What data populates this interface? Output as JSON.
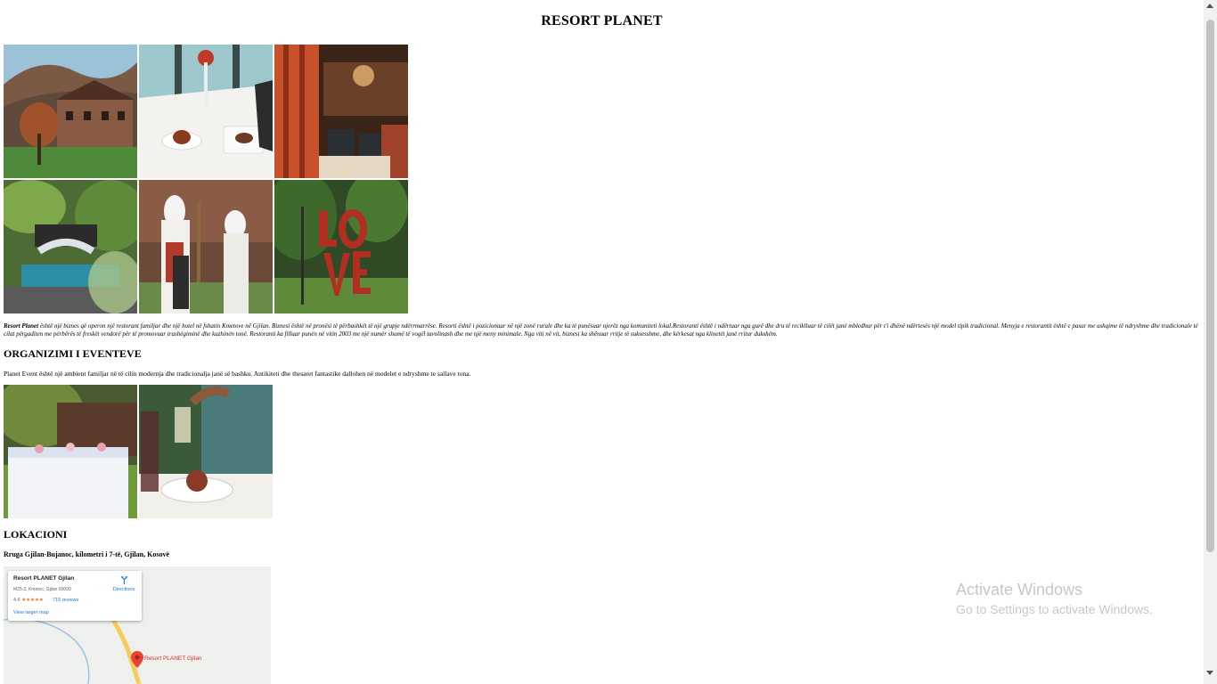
{
  "page": {
    "title": "RESORT PLANET"
  },
  "gallery": {
    "images": [
      {
        "name": "resort-exterior-photo",
        "alt": "resort exterior"
      },
      {
        "name": "table-dessert-photo",
        "alt": "dessert table"
      },
      {
        "name": "restaurant-interior-photo",
        "alt": "restaurant interior"
      },
      {
        "name": "pool-bridge-photo",
        "alt": "pool bridge"
      },
      {
        "name": "traditional-dress-photo",
        "alt": "traditional dress"
      },
      {
        "name": "love-sculpture-photo",
        "alt": "love sculpture"
      }
    ]
  },
  "intro": {
    "brand": "Resort Planet",
    "text": " është një biznes që operon një restorant familjar dhe një hotel në fshatin Kmetove në Gjilan. Biznesi është në pronësi të përbashkët të një grupje ndërrmarrëse. Resorti është i pozicionuar në një zonë rurale dhe ka të punësuar njerëz nga komuniteti lokal.Restoranti është i ndërtuar nga gurë dhe dru të reciklluar të cilët janë mbledhur për t'i dhënë ndërtesës një model tipik tradicional. Menyja e restorantit është e pasur me ushqime të ndryshme dhe tradicionale të cilat përgaditen me përbërës të freskët vendorë për të promovuar trashëgiminë dhe kuzhinën tonë. Restoranti ka filluar punën në vitin 2003 me një numër shumë të vogël tavolinash dhe me një meny minimale. Nga viti në vit, biznesi ka shënuar rritje të suksesshme, dhe kërkesat nga klinetët janë rritur dukshëm."
  },
  "events": {
    "heading": "ORGANIZIMI I EVENTEVE",
    "text": "Planet Event është një ambient familjar në të cilin modernja dhe tradicionalja janë së bashku. Antikiteti dhe thesaret fantastike dallohen në modelet e ndryshme te sallave tona."
  },
  "location": {
    "heading": "LOKACIONI",
    "address": "Rruga Gjilan-Bujanoc, kilometri i 7-të, Gjilan, Kosovë",
    "map": {
      "place_name": "Resort PLANET Gjilan",
      "place_address": "M25-3, Kmetoc, Gjilan 60000",
      "rating": "4.6",
      "stars": "★★★★★",
      "reviews": "715 reviews",
      "directions_label": "Directions",
      "larger_map_label": "View larger map",
      "pin_label": "Resort PLANET Gjilan"
    }
  },
  "watermark": {
    "line1": "Activate Windows",
    "line2": "Go to Settings to activate Windows."
  }
}
